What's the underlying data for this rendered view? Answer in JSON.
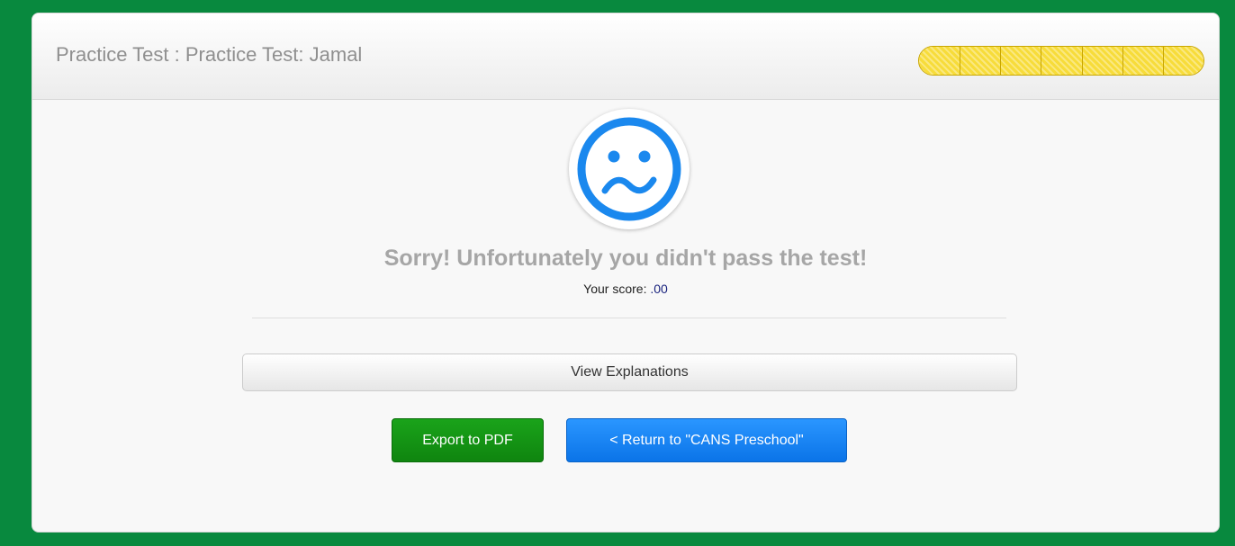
{
  "header": {
    "title": "Practice Test : Practice Test: Jamal",
    "progress": {
      "segments": 7,
      "filled": 7,
      "fill_color": "#f7dc3a",
      "border_color": "#c9a600"
    }
  },
  "result": {
    "face_icon": "sad-face-icon",
    "face_color": "#1a88ee",
    "message": "Sorry! Unfortunately you didn't pass the test!",
    "score_label": "Your score:",
    "score_value": ".00"
  },
  "actions": {
    "view_explanations": "View Explanations",
    "export_pdf": "Export to PDF",
    "return": "< Return to \"CANS Preschool\""
  },
  "colors": {
    "page_background": "#08893e",
    "export_button": "#149414",
    "return_button": "#1680f2"
  }
}
